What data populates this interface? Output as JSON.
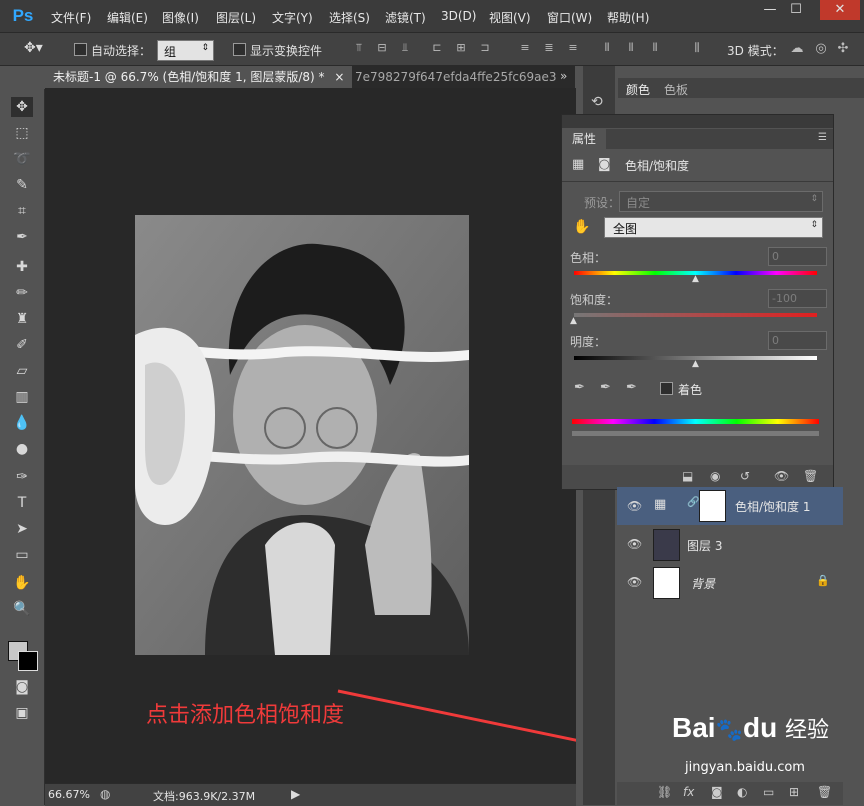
{
  "app": {
    "logo": "Ps"
  },
  "menu": [
    "文件(F)",
    "编辑(E)",
    "图像(I)",
    "图层(L)",
    "文字(Y)",
    "选择(S)",
    "滤镜(T)",
    "3D(D)",
    "视图(V)",
    "窗口(W)",
    "帮助(H)"
  ],
  "window_controls": {
    "minimize": "—",
    "maximize": "☐",
    "close": "✕"
  },
  "options": {
    "auto_select_label": "自动选择：",
    "group_value": "组",
    "show_transform_label": "显示变换控件",
    "mode_3d_label": "3D 模式："
  },
  "tabs": [
    {
      "label": "未标题-1 @ 66.7% (色相/饱和度 1, 图层蒙版/8) *",
      "close": "×",
      "active": true
    },
    {
      "label": "7e798279f647efda4ffe25fc69ae3",
      "active": false
    }
  ],
  "annotation": "点击添加色相饱和度",
  "status": {
    "zoom": "66.67%",
    "doc": "文档:963.9K/2.37M"
  },
  "panel_tabs": {
    "color": "颜色",
    "swatches": "色板"
  },
  "properties": {
    "tab": "属性",
    "title": "色相/饱和度",
    "preset_label": "预设：",
    "preset_value": "自定",
    "channel_value": "全图",
    "hue": {
      "label": "色相：",
      "value": "0"
    },
    "saturation": {
      "label": "饱和度：",
      "value": "-100"
    },
    "lightness": {
      "label": "明度：",
      "value": "0"
    },
    "colorize_label": "着色"
  },
  "layers": [
    {
      "name": "色相/饱和度 1",
      "selected": true
    },
    {
      "name": "图层 3",
      "selected": false
    },
    {
      "name": "背景",
      "selected": false,
      "locked": true
    }
  ],
  "watermark": {
    "brand_a": "Bai",
    "brand_b": "du",
    "suffix": "经验",
    "url": "jingyan.baidu.com"
  },
  "colors": {
    "accent": "#31a8ff",
    "annotation": "#f03a3a",
    "selected_layer": "#4a5f7f"
  }
}
